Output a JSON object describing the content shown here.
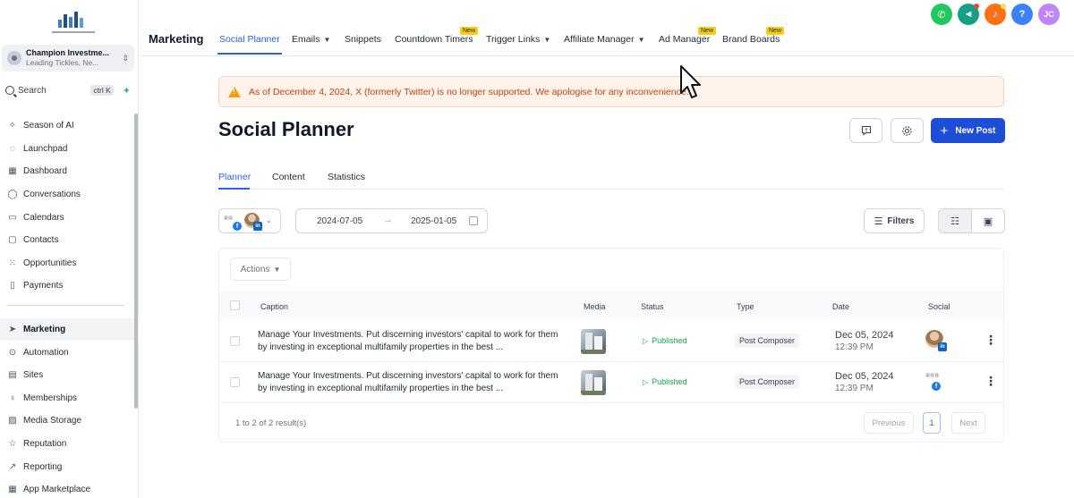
{
  "sidebar": {
    "account": {
      "name": "Champion Investme...",
      "subtitle": "Leading Tickles, Ne..."
    },
    "search": {
      "label": "Search",
      "shortcut": "ctrl K"
    },
    "items": [
      {
        "label": "Season of AI",
        "icon": "sparkles-icon"
      },
      {
        "label": "Launchpad",
        "icon": "rocket-icon"
      },
      {
        "label": "Dashboard",
        "icon": "grid-icon"
      },
      {
        "label": "Conversations",
        "icon": "chat-bubble-icon"
      },
      {
        "label": "Calendars",
        "icon": "calendar-icon"
      },
      {
        "label": "Contacts",
        "icon": "contacts-icon"
      },
      {
        "label": "Opportunities",
        "icon": "opportunities-icon"
      },
      {
        "label": "Payments",
        "icon": "payments-icon"
      }
    ],
    "items2": [
      {
        "label": "Marketing",
        "icon": "send-icon",
        "active": true
      },
      {
        "label": "Automation",
        "icon": "automation-icon"
      },
      {
        "label": "Sites",
        "icon": "sites-icon"
      },
      {
        "label": "Memberships",
        "icon": "memberships-icon"
      },
      {
        "label": "Media Storage",
        "icon": "image-icon"
      },
      {
        "label": "Reputation",
        "icon": "star-icon"
      },
      {
        "label": "Reporting",
        "icon": "trend-icon"
      },
      {
        "label": "App Marketplace",
        "icon": "apps-icon"
      }
    ]
  },
  "topbar": {
    "section": "Marketing",
    "tabs": [
      {
        "label": "Social Planner",
        "active": true
      },
      {
        "label": "Emails",
        "dropdown": true
      },
      {
        "label": "Snippets"
      },
      {
        "label": "Countdown Timers",
        "badge": "New"
      },
      {
        "label": "Trigger Links",
        "dropdown": true
      },
      {
        "label": "Affiliate Manager",
        "dropdown": true
      },
      {
        "label": "Ad Manager",
        "badge": "New"
      },
      {
        "label": "Brand Boards",
        "badge": "New"
      }
    ],
    "user_initials": "JC",
    "help_glyph": "?"
  },
  "banner": {
    "text": "As of December 4, 2024, X (formerly Twitter) is no longer supported. We apologise for any inconvenience."
  },
  "page": {
    "title": "Social Planner",
    "new_post_label": "New Post",
    "subtabs": [
      "Planner",
      "Content",
      "Statistics"
    ],
    "date_start": "2024-07-05",
    "date_end": "2025-01-05",
    "filters_label": "Filters"
  },
  "table": {
    "actions_label": "Actions",
    "headers": {
      "caption": "Caption",
      "media": "Media",
      "status": "Status",
      "type": "Type",
      "date": "Date",
      "social": "Social"
    },
    "rows": [
      {
        "caption": "Manage Your Investments. Put discerning investors' capital to work for them by investing in exceptional multifamily properties in the best ...",
        "status": "Published",
        "type": "Post Composer",
        "date": "Dec 05, 2024",
        "time": "12:39 PM",
        "social": "linkedin"
      },
      {
        "caption": "Manage Your Investments. Put discerning investors' capital to work for them by investing in exceptional multifamily properties in the best ...",
        "status": "Published",
        "type": "Post Composer",
        "date": "Dec 05, 2024",
        "time": "12:39 PM",
        "social": "facebook"
      }
    ],
    "footer": "1 to 2 of 2 result(s)",
    "pager": {
      "previous": "Previous",
      "current": "1",
      "next": "Next"
    }
  },
  "colors": {
    "accent": "#2563eb",
    "primary_button": "#1d4ed8",
    "published": "#16a34a",
    "banner_text": "#c2410c",
    "badge": "#facc15"
  }
}
